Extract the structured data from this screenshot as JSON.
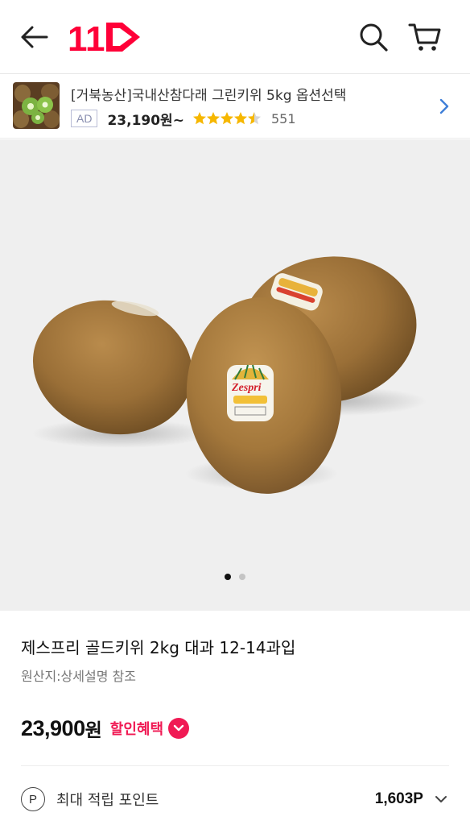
{
  "header": {
    "logo_text": "11",
    "back_icon": "arrow-left-icon",
    "search_icon": "search-icon",
    "cart_icon": "cart-icon",
    "brand_color": "#ff0038"
  },
  "ad": {
    "title": "[거북농산]국내산참다래 그린키위 5kg 옵션선택",
    "badge": "AD",
    "price": "23,190원~",
    "rating": 4.5,
    "review_count": "551",
    "chevron_icon": "chevron-right-icon"
  },
  "gallery": {
    "image_count": 2,
    "active_index": 0
  },
  "product": {
    "name": "제스프리 골드키위 2kg 대과 12-14과입",
    "origin": "원산지:상세설명 참조",
    "price": "23,900",
    "price_unit": "원",
    "benefit_label": "할인혜택",
    "accent_color": "#f01a54"
  },
  "points": {
    "icon_letter": "P",
    "label": "최대 적립 포인트",
    "value": "1,603P"
  }
}
